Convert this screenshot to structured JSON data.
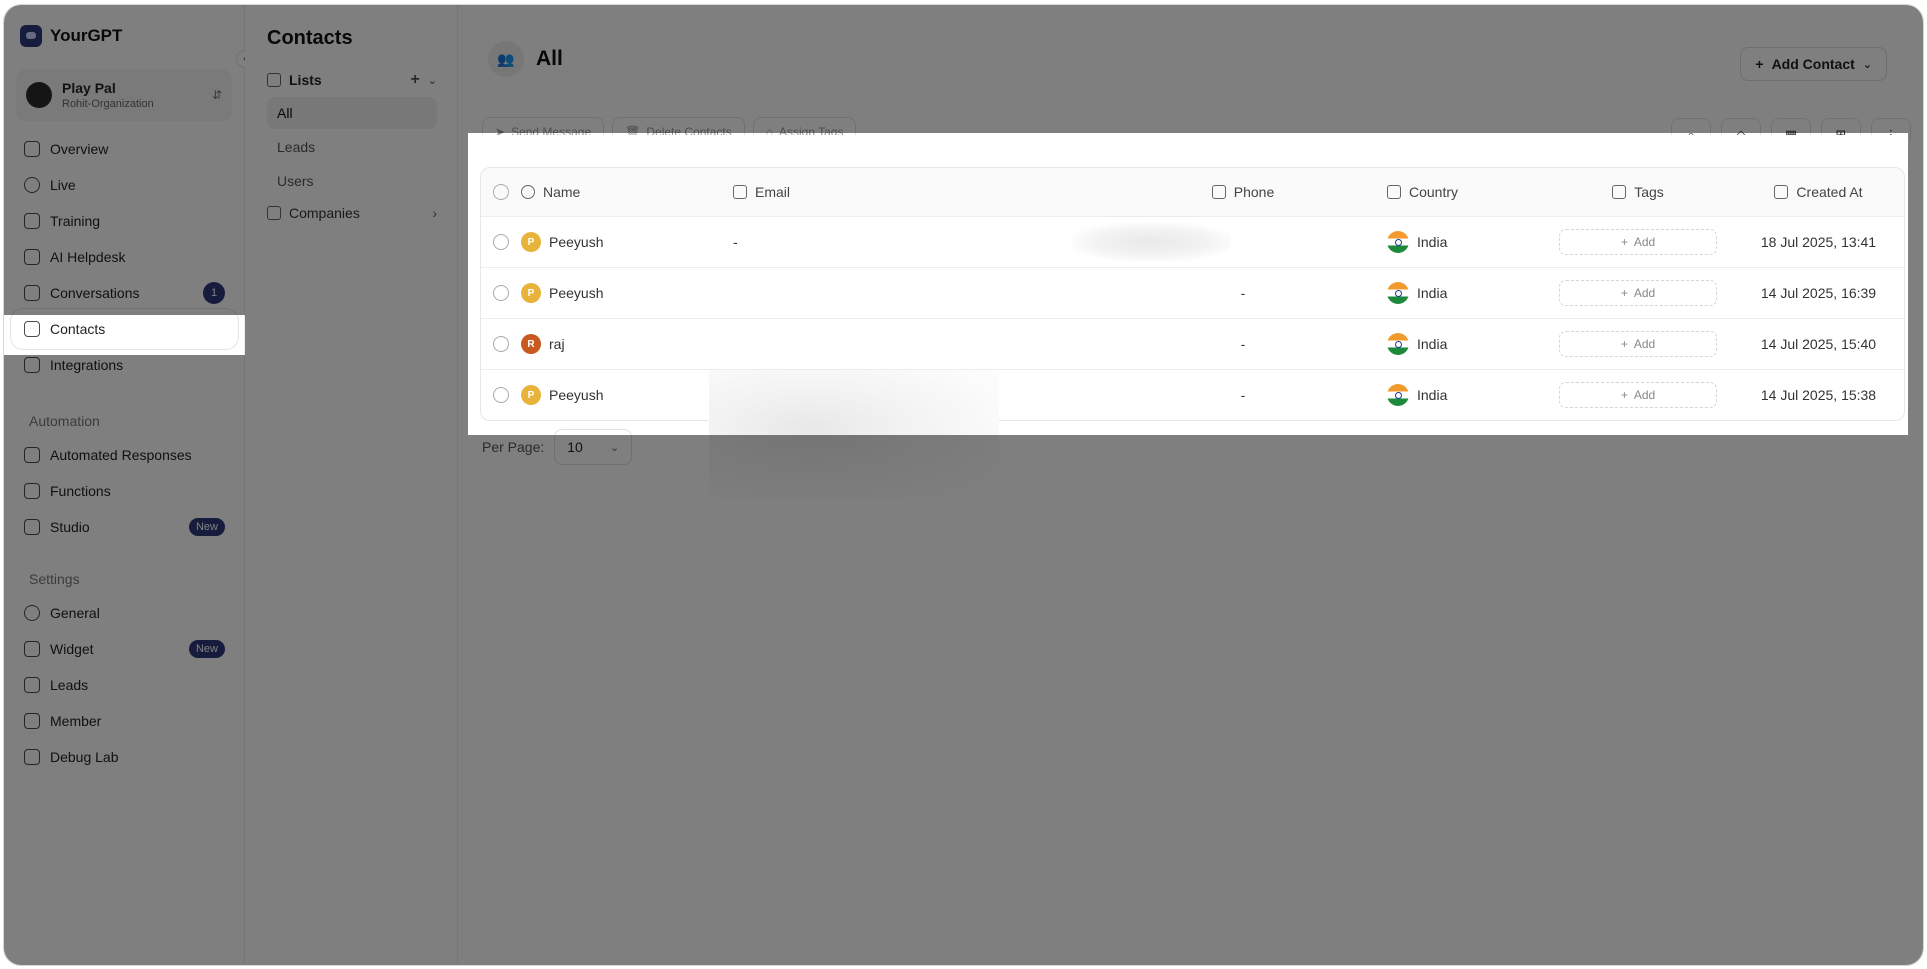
{
  "brand": {
    "name": "YourGPT"
  },
  "workspace": {
    "title": "Play Pal",
    "subtitle": "Rohit-Organization"
  },
  "sidebar": {
    "items": [
      {
        "label": "Overview",
        "icon": "layout-icon"
      },
      {
        "label": "Live",
        "icon": "broadcast-icon"
      },
      {
        "label": "Training",
        "icon": "brain-icon"
      },
      {
        "label": "AI Helpdesk",
        "icon": "book-icon"
      },
      {
        "label": "Conversations",
        "icon": "chat-icon",
        "count": "1"
      },
      {
        "label": "Contacts",
        "icon": "contact-card-icon"
      },
      {
        "label": "Integrations",
        "icon": "puzzle-icon"
      }
    ],
    "automation_label": "Automation",
    "automation_items": [
      {
        "label": "Automated Responses",
        "icon": "reply-icon"
      },
      {
        "label": "Functions",
        "icon": "function-icon"
      },
      {
        "label": "Studio",
        "icon": "workflow-icon",
        "badge": "New"
      }
    ],
    "settings_label": "Settings",
    "settings_items": [
      {
        "label": "General",
        "icon": "gear-icon"
      },
      {
        "label": "Widget",
        "icon": "widget-icon",
        "badge": "New"
      },
      {
        "label": "Leads",
        "icon": "user-plus-icon"
      },
      {
        "label": "Member",
        "icon": "users-icon"
      },
      {
        "label": "Debug Lab",
        "icon": "flask-icon"
      }
    ]
  },
  "lists": {
    "title": "Contacts",
    "header": "Lists",
    "items": [
      "All",
      "Leads",
      "Users"
    ],
    "companies": "Companies"
  },
  "main": {
    "title": "All",
    "add_contact": "Add Contact",
    "toolbar": {
      "send_message": "Send Message",
      "delete_contacts": "Delete Contacts",
      "assign_tags": "Assign Tags"
    },
    "columns": {
      "name": "Name",
      "email": "Email",
      "phone": "Phone",
      "country": "Country",
      "tags": "Tags",
      "created": "Created At"
    },
    "rows": [
      {
        "initial": "P",
        "name": "Peeyush",
        "email": "-",
        "phone": "",
        "country": "India",
        "tag_add": "Add",
        "created": "18 Jul 2025, 13:41",
        "color": "#e8b33a"
      },
      {
        "initial": "P",
        "name": "Peeyush",
        "email": "",
        "phone": "-",
        "country": "India",
        "tag_add": "Add",
        "created": "14 Jul 2025, 16:39",
        "color": "#e8b33a"
      },
      {
        "initial": "R",
        "name": "raj",
        "email": "",
        "phone": "-",
        "country": "India",
        "tag_add": "Add",
        "created": "14 Jul 2025, 15:40",
        "color": "#c95a1f"
      },
      {
        "initial": "P",
        "name": "Peeyush",
        "email": "",
        "phone": "-",
        "country": "India",
        "tag_add": "Add",
        "created": "14 Jul 2025, 15:38",
        "color": "#e8b33a"
      }
    ],
    "per_page_label": "Per Page:",
    "per_page_value": "10"
  },
  "colors": {
    "accent": "#2c3a78",
    "overlay": "rgba(0,0,0,0.5)"
  }
}
